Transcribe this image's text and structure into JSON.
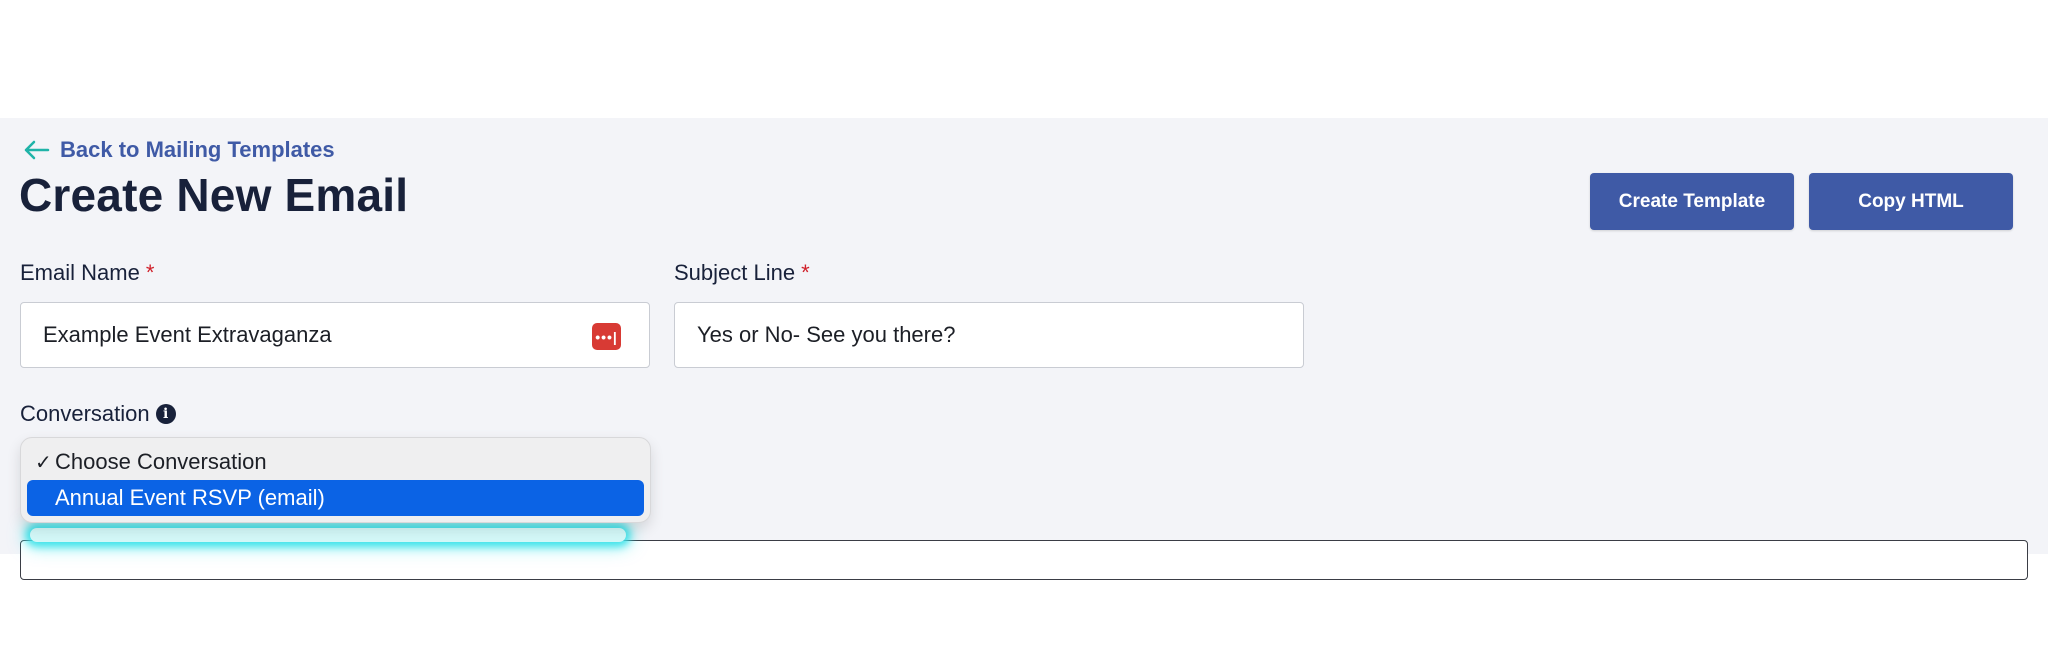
{
  "nav": {
    "back_label": "Back to Mailing Templates"
  },
  "header": {
    "title": "Create New Email",
    "create_template_label": "Create Template",
    "copy_html_label": "Copy HTML"
  },
  "form": {
    "email_name": {
      "label": "Email Name",
      "required_mark": "*",
      "value": "Example Event Extravaganza",
      "icon": "password-manager-icon",
      "icon_glyph": "•••|"
    },
    "subject_line": {
      "label": "Subject Line",
      "required_mark": "*",
      "value": "Yes or No- See you there?"
    },
    "conversation": {
      "label": "Conversation",
      "info_glyph": "i",
      "options": [
        {
          "label": "Choose Conversation",
          "selected": true,
          "check": "✓"
        },
        {
          "label": "Annual Event RSVP (email)",
          "highlighted": true
        }
      ]
    }
  },
  "colors": {
    "accent": "#3f5aa6",
    "title": "#18213a",
    "required": "#d0202a",
    "highlight": "#0b63e5",
    "panel_bg": "#f3f4f8",
    "glow": "#3ee3ea"
  }
}
